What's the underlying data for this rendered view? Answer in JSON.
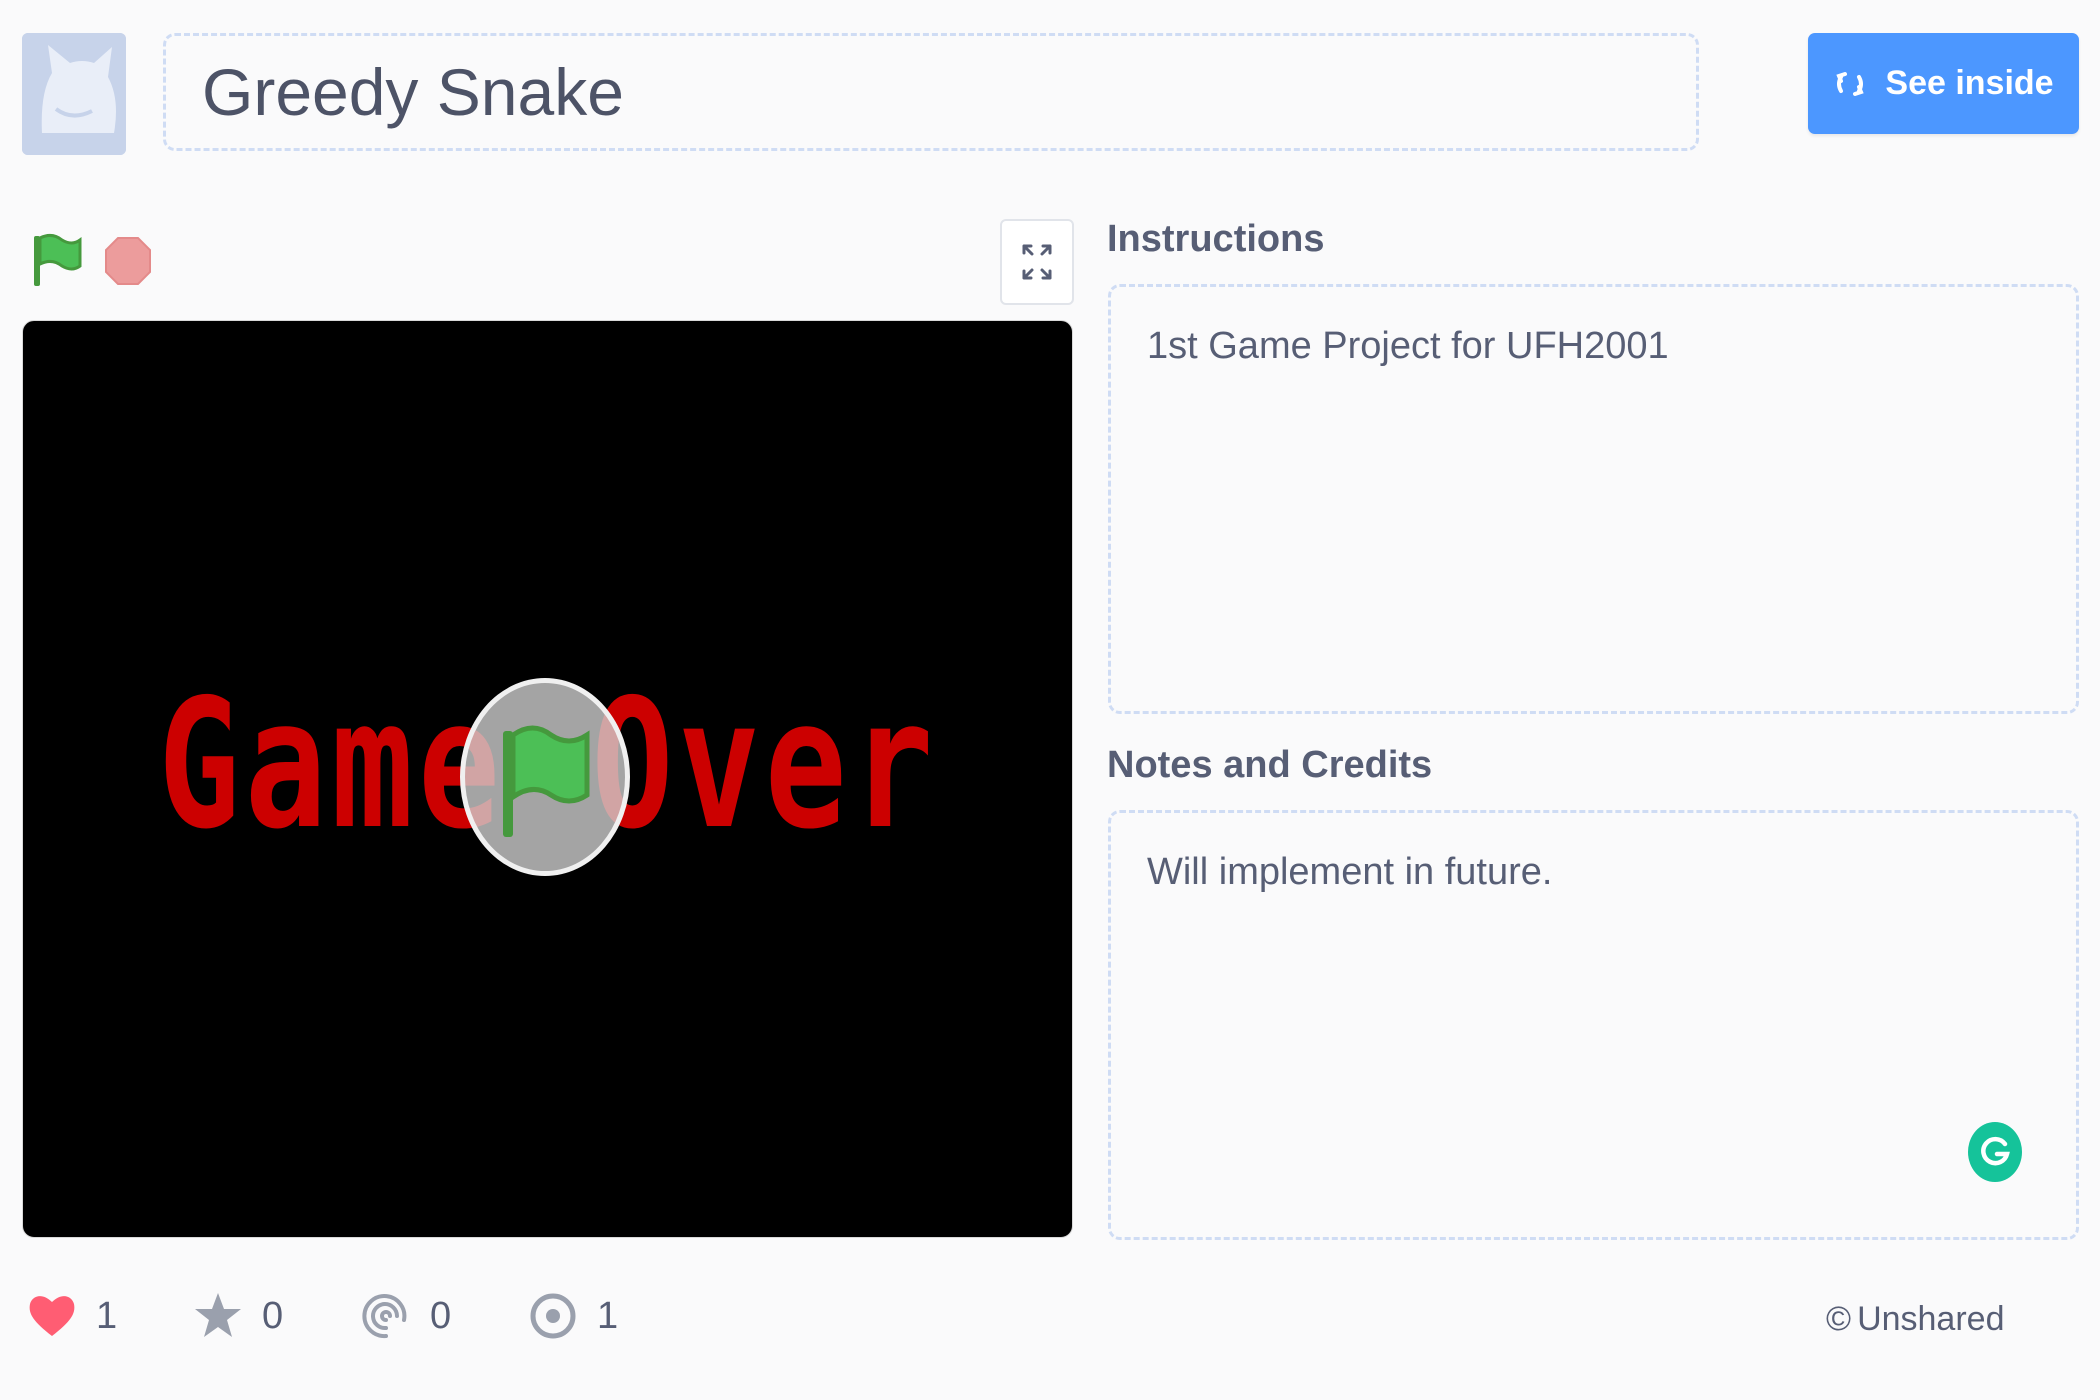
{
  "header": {
    "project_title": "Greedy Snake",
    "see_inside_label": "See inside"
  },
  "stage": {
    "screen_text": "Game Over",
    "screen_text_color": "#cc0000"
  },
  "instructions": {
    "heading": "Instructions",
    "text": "1st Game Project for UFH2001"
  },
  "notes": {
    "heading": "Notes and Credits",
    "text": "Will implement in future."
  },
  "stats": {
    "loves": "1",
    "favorites": "0",
    "remixes": "0",
    "views": "1"
  },
  "footer": {
    "share_status": "Unshared"
  },
  "colors": {
    "accent": "#4c97ff",
    "love": "#ff5d73",
    "flag": "#4cbf56",
    "stop": "#ec9c9c",
    "grammarly": "#15c39a"
  },
  "icons": [
    "user-avatar",
    "see-inside-icon",
    "green-flag-icon",
    "stop-icon",
    "fullscreen-icon",
    "heart-icon",
    "star-icon",
    "remix-icon",
    "views-icon",
    "grammarly-icon"
  ]
}
